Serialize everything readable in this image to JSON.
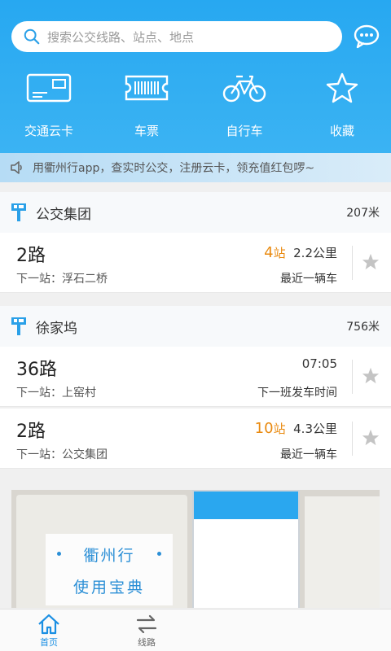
{
  "search": {
    "placeholder": "搜索公交线路、站点、地点"
  },
  "quick": [
    {
      "label": "交通云卡",
      "icon": "card-icon"
    },
    {
      "label": "车票",
      "icon": "ticket-icon"
    },
    {
      "label": "自行车",
      "icon": "bicycle-icon"
    },
    {
      "label": "收藏",
      "icon": "star-icon"
    }
  ],
  "notice": {
    "text": "用衢州行app，查实时公交，注册云卡，领充值红包啰~"
  },
  "stations": [
    {
      "name": "公交集团",
      "distance": "207米",
      "routes": [
        {
          "line": "2路",
          "next": "下一站：浮石二桥",
          "stops_num": "4",
          "stops_unit": "站",
          "dist": "2.2公里",
          "status": "最近一辆车"
        }
      ]
    },
    {
      "name": "徐家坞",
      "distance": "756米",
      "routes": [
        {
          "line": "36路",
          "next": "下一站：上窑村",
          "time": "07:05",
          "status": "下一班发车时间"
        },
        {
          "line": "2路",
          "next": "下一站：公交集团",
          "stops_num": "10",
          "stops_unit": "站",
          "dist": "4.3公里",
          "status": "最近一辆车"
        }
      ]
    }
  ],
  "banner": {
    "line1": "衢州行",
    "line2": "使用宝典"
  },
  "tabs": [
    {
      "label": "首页",
      "active": true
    },
    {
      "label": "线路",
      "active": false
    }
  ],
  "colors": {
    "brand": "#27a8f1",
    "accent_orange": "#e98a10",
    "tab_active": "#1a8fe3"
  }
}
